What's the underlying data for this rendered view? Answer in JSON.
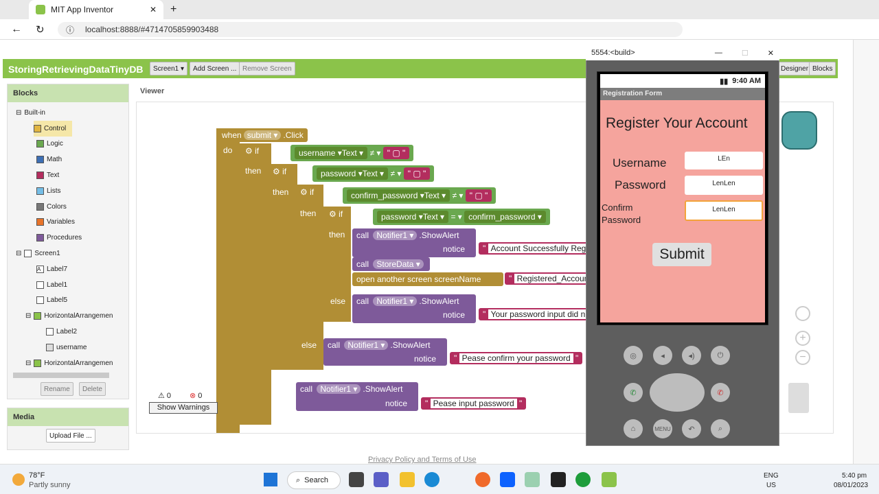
{
  "browser": {
    "tab_title": "MIT App Inventor",
    "url": "localhost:8888/#4714705859903488"
  },
  "app": {
    "project": "StoringRetrievingDataTinyDB",
    "screen": "Screen1 ▾",
    "add_screen": "Add Screen ...",
    "remove_screen": "Remove Screen",
    "designer": "Designer",
    "blocks": "Blocks"
  },
  "blocks_panel": {
    "title": "Blocks",
    "builtin": "Built-in",
    "items": [
      "Control",
      "Logic",
      "Math",
      "Text",
      "Lists",
      "Colors",
      "Variables",
      "Procedures"
    ],
    "screen": "Screen1",
    "components": [
      "Label7",
      "Label1",
      "Label5",
      "HorizontalArrangemen",
      "Label2",
      "username",
      "HorizontalArrangemen"
    ],
    "rename": "Rename",
    "delete": "Delete"
  },
  "media": {
    "title": "Media",
    "upload": "Upload File ..."
  },
  "viewer": {
    "title": "Viewer",
    "warn_count": "0",
    "error_count": "0",
    "show_warnings": "Show Warnings"
  },
  "code": {
    "when": "when",
    "submit": "submit ▾",
    ".click": ".Click",
    "do": "do",
    "if": "if",
    "then": "then",
    "else": "else",
    "username": "username ▾",
    "password": "password ▾",
    "confirm_password": "confirm_password ▾",
    "text": "Text ▾",
    "neq": "≠ ▾",
    "eq": "= ▾",
    "call": "call",
    "notifier": "Notifier1 ▾",
    "showalert": ".ShowAlert",
    "notice": "notice",
    "storedata": "StoreData ▾",
    "open_screen": "open another screen  screenName",
    "msg_success": "Account Successfully Reg",
    "msg_registered": "Registered_Accoun",
    "msg_password": "Your password input did n",
    "msg_confirm": "Pease confirm your password",
    "msg_input": "Pease input password"
  },
  "emulator": {
    "title": "5554:<build>",
    "time": "9:40 AM",
    "app_title": "Registration Form",
    "heading": "Register Your Account",
    "username_label": "Username",
    "password_label": "Password",
    "confirm_label": "Confirm\nPassword",
    "username_val": "LEn",
    "password_val": "LenLen",
    "confirm_val": "LenLen",
    "submit": "Submit"
  },
  "footer": {
    "privacy": "Privacy Policy and Terms of Use"
  },
  "taskbar": {
    "temp": "78°F",
    "weather": "Partly sunny",
    "search": "Search",
    "lang1": "ENG",
    "lang2": "US",
    "time": "5:40 pm",
    "date": "08/01/2023"
  }
}
